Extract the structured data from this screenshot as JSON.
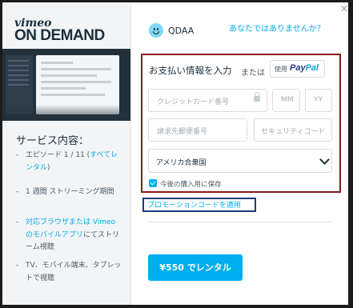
{
  "brand": {
    "logo_top": "vimeo",
    "logo_bottom": "ON DEMAND"
  },
  "features": {
    "title": "サービス内容：",
    "items": [
      {
        "text": "エピソード 1 / 11 (",
        "link": "すべてレンタル",
        "suffix": ")"
      },
      {
        "text": "1 週間 ストリーミング期間"
      },
      {
        "link": "対応ブラウザまたは Vimeo のモバイルアプリ",
        "text": "にてストリーム視聴"
      },
      {
        "text": "TV、モバイル端末、タブレットで視聴"
      }
    ]
  },
  "account": {
    "username": "QDAA",
    "not_you_link": "あなたではありませんか？"
  },
  "payment": {
    "title": "お支払い情報を入力",
    "or_label": "または",
    "paypal": {
      "use_label": "使用",
      "brand_part1": "Pay",
      "brand_part2": "Pal"
    },
    "card_number_placeholder": "クレジットカード番号",
    "month_placeholder": "MM",
    "year_placeholder": "YY",
    "postal_code_placeholder": "請求先郵便番号",
    "security_code_placeholder": "セキュリティコード",
    "country_value": "アメリカ合衆国",
    "save_label": "今後の購入用に保存",
    "save_checked": true
  },
  "promo_link": "プロモーションコードを適用",
  "rent_button": "¥550 でレンタル",
  "colors": {
    "accent": "#00adef",
    "highlight_payment_box": "#8b1a1a",
    "highlight_promo_box": "#1b3a78"
  }
}
